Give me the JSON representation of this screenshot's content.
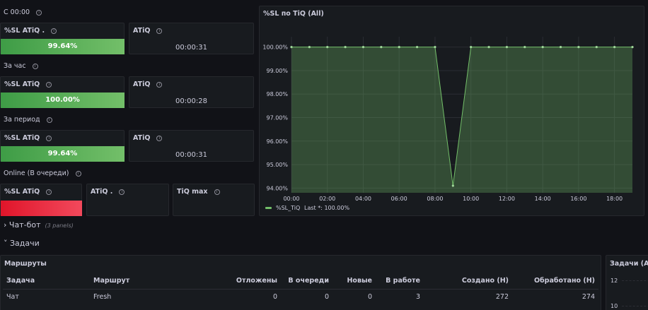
{
  "left": {
    "rows": [
      {
        "title": "С 00:00",
        "sl_label": "%SL ATiQ .",
        "sl_value": "99.64%",
        "atiq_label": "ATiQ",
        "atiq_value": "00:00:31"
      },
      {
        "title": "За час",
        "sl_label": "%SL ATiQ",
        "sl_value": "100.00%",
        "atiq_label": "ATiQ",
        "atiq_value": "00:00:28"
      },
      {
        "title": "За период",
        "sl_label": "%SL ATiQ",
        "sl_value": "99.64%",
        "atiq_label": "ATiQ",
        "atiq_value": "00:00:31"
      }
    ],
    "online": {
      "title": "Online (В очереди)",
      "sl_label": "%SL ATiQ",
      "atiq_label": "ATiQ .",
      "tiqmax_label": "TiQ max"
    }
  },
  "chart_panel": {
    "title": "%SL по TiQ (All)"
  },
  "chart_data": {
    "type": "area",
    "title": "%SL по TiQ (All)",
    "x": [
      "00:00",
      "01:00",
      "02:00",
      "03:00",
      "04:00",
      "05:00",
      "06:00",
      "07:00",
      "08:00",
      "09:00",
      "10:00",
      "11:00",
      "12:00",
      "13:00",
      "14:00",
      "15:00",
      "16:00",
      "17:00",
      "18:00",
      "19:00"
    ],
    "series": [
      {
        "name": "%SL_TiQ",
        "values": [
          100,
          100,
          100,
          100,
          100,
          100,
          100,
          100,
          100,
          94.1,
          100,
          100,
          100,
          100,
          100,
          100,
          100,
          100,
          100,
          100
        ]
      }
    ],
    "y_ticks": [
      "100.00%",
      "99.00%",
      "98.00%",
      "97.00%",
      "96.00%",
      "95.00%",
      "94.00%"
    ],
    "x_ticks": [
      "00:00",
      "02:00",
      "04:00",
      "06:00",
      "08:00",
      "10:00",
      "12:00",
      "14:00",
      "16:00",
      "18:00"
    ],
    "ylim": [
      93.8,
      100.2
    ],
    "grid": true,
    "legend_placement": "bottom-left",
    "legend_text": "%SL_TiQ",
    "legend_last": "Last *: 100.00%",
    "color": "#73bf69"
  },
  "sections": {
    "chatbot": {
      "label": "Чат-бот",
      "sub": "(3 panels)"
    },
    "tasks": {
      "label": "Задачи"
    }
  },
  "routes": {
    "title": "Маршруты",
    "columns": [
      "Задача",
      "Маршрут",
      "Отложены",
      "В очереди",
      "Новые",
      "В работе",
      "Создано (Н)",
      "Обработано (Н)"
    ],
    "rows": [
      [
        "Чат",
        "Fresh",
        "0",
        "0",
        "0",
        "3",
        "272",
        "274"
      ]
    ]
  },
  "tasks_panel": {
    "title": "Задачи (All)",
    "y_ticks": [
      "12",
      "10"
    ]
  },
  "icons": {
    "info": "info-circle-icon",
    "chevron_right": "chevron-right-icon",
    "chevron_down": "chevron-down-icon"
  },
  "colors": {
    "green": "#73bf69",
    "red": "#f2495c",
    "bg": "#111217",
    "panel": "#181b1f"
  }
}
